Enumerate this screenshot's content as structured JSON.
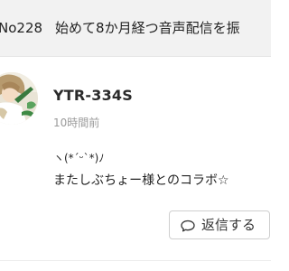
{
  "header": {
    "episode_number": "No228",
    "episode_title": "始めて8か月経つ音声配信を振"
  },
  "comment": {
    "author": "YTR-334S",
    "time_ago": "10時間前",
    "text_line1": "ヽ(*´ᵕ`*)ﾉ",
    "text_line2": "またしぶちょー様とのコラボ☆"
  },
  "actions": {
    "reply_label": "返信する",
    "reply_icon": "speech-bubble-icon"
  },
  "colors": {
    "header_background": "#f2f2f2",
    "muted_text": "#9a9a9a",
    "button_border": "#cfcfcf"
  }
}
